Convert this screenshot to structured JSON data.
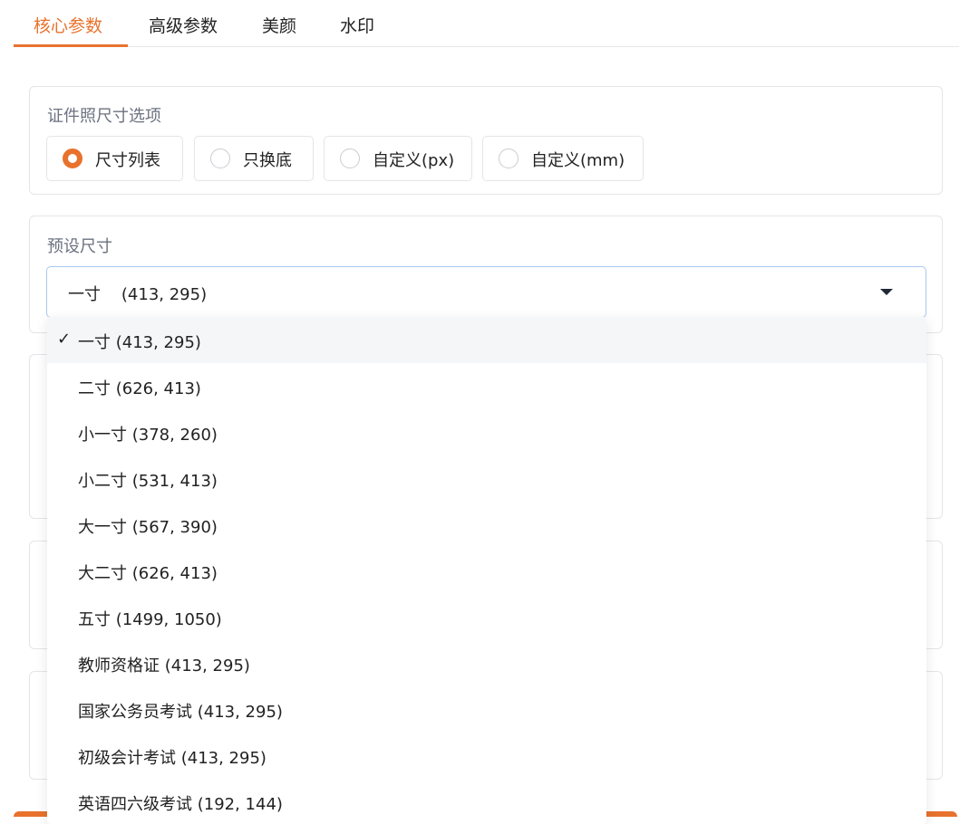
{
  "tabs": [
    {
      "label": "核心参数",
      "active": true
    },
    {
      "label": "高级参数",
      "active": false
    },
    {
      "label": "美颜",
      "active": false
    },
    {
      "label": "水印",
      "active": false
    }
  ],
  "size_option": {
    "label": "证件照尺寸选项",
    "options": [
      {
        "label": "尺寸列表",
        "checked": true
      },
      {
        "label": "只换底",
        "checked": false
      },
      {
        "label": "自定义(px)",
        "checked": false
      },
      {
        "label": "自定义(mm)",
        "checked": false
      }
    ]
  },
  "preset": {
    "label": "预设尺寸",
    "value": "一寸    (413, 295)"
  },
  "dropdown": {
    "selected_mark": "✓",
    "items": [
      "一寸 (413, 295)",
      "二寸 (626, 413)",
      "小一寸 (378, 260)",
      "小二寸 (531, 413)",
      "大一寸 (567, 390)",
      "大二寸 (626, 413)",
      "五寸 (1499, 1050)",
      "教师资格证 (413, 295)",
      "国家公务员考试 (413, 295)",
      "初级会计考试 (413, 295)",
      "英语四六级考试 (192, 144)"
    ]
  },
  "colors": {
    "accent": "#e8722d",
    "border": "#e3e5e8",
    "focus_border": "#a9c8f0"
  }
}
